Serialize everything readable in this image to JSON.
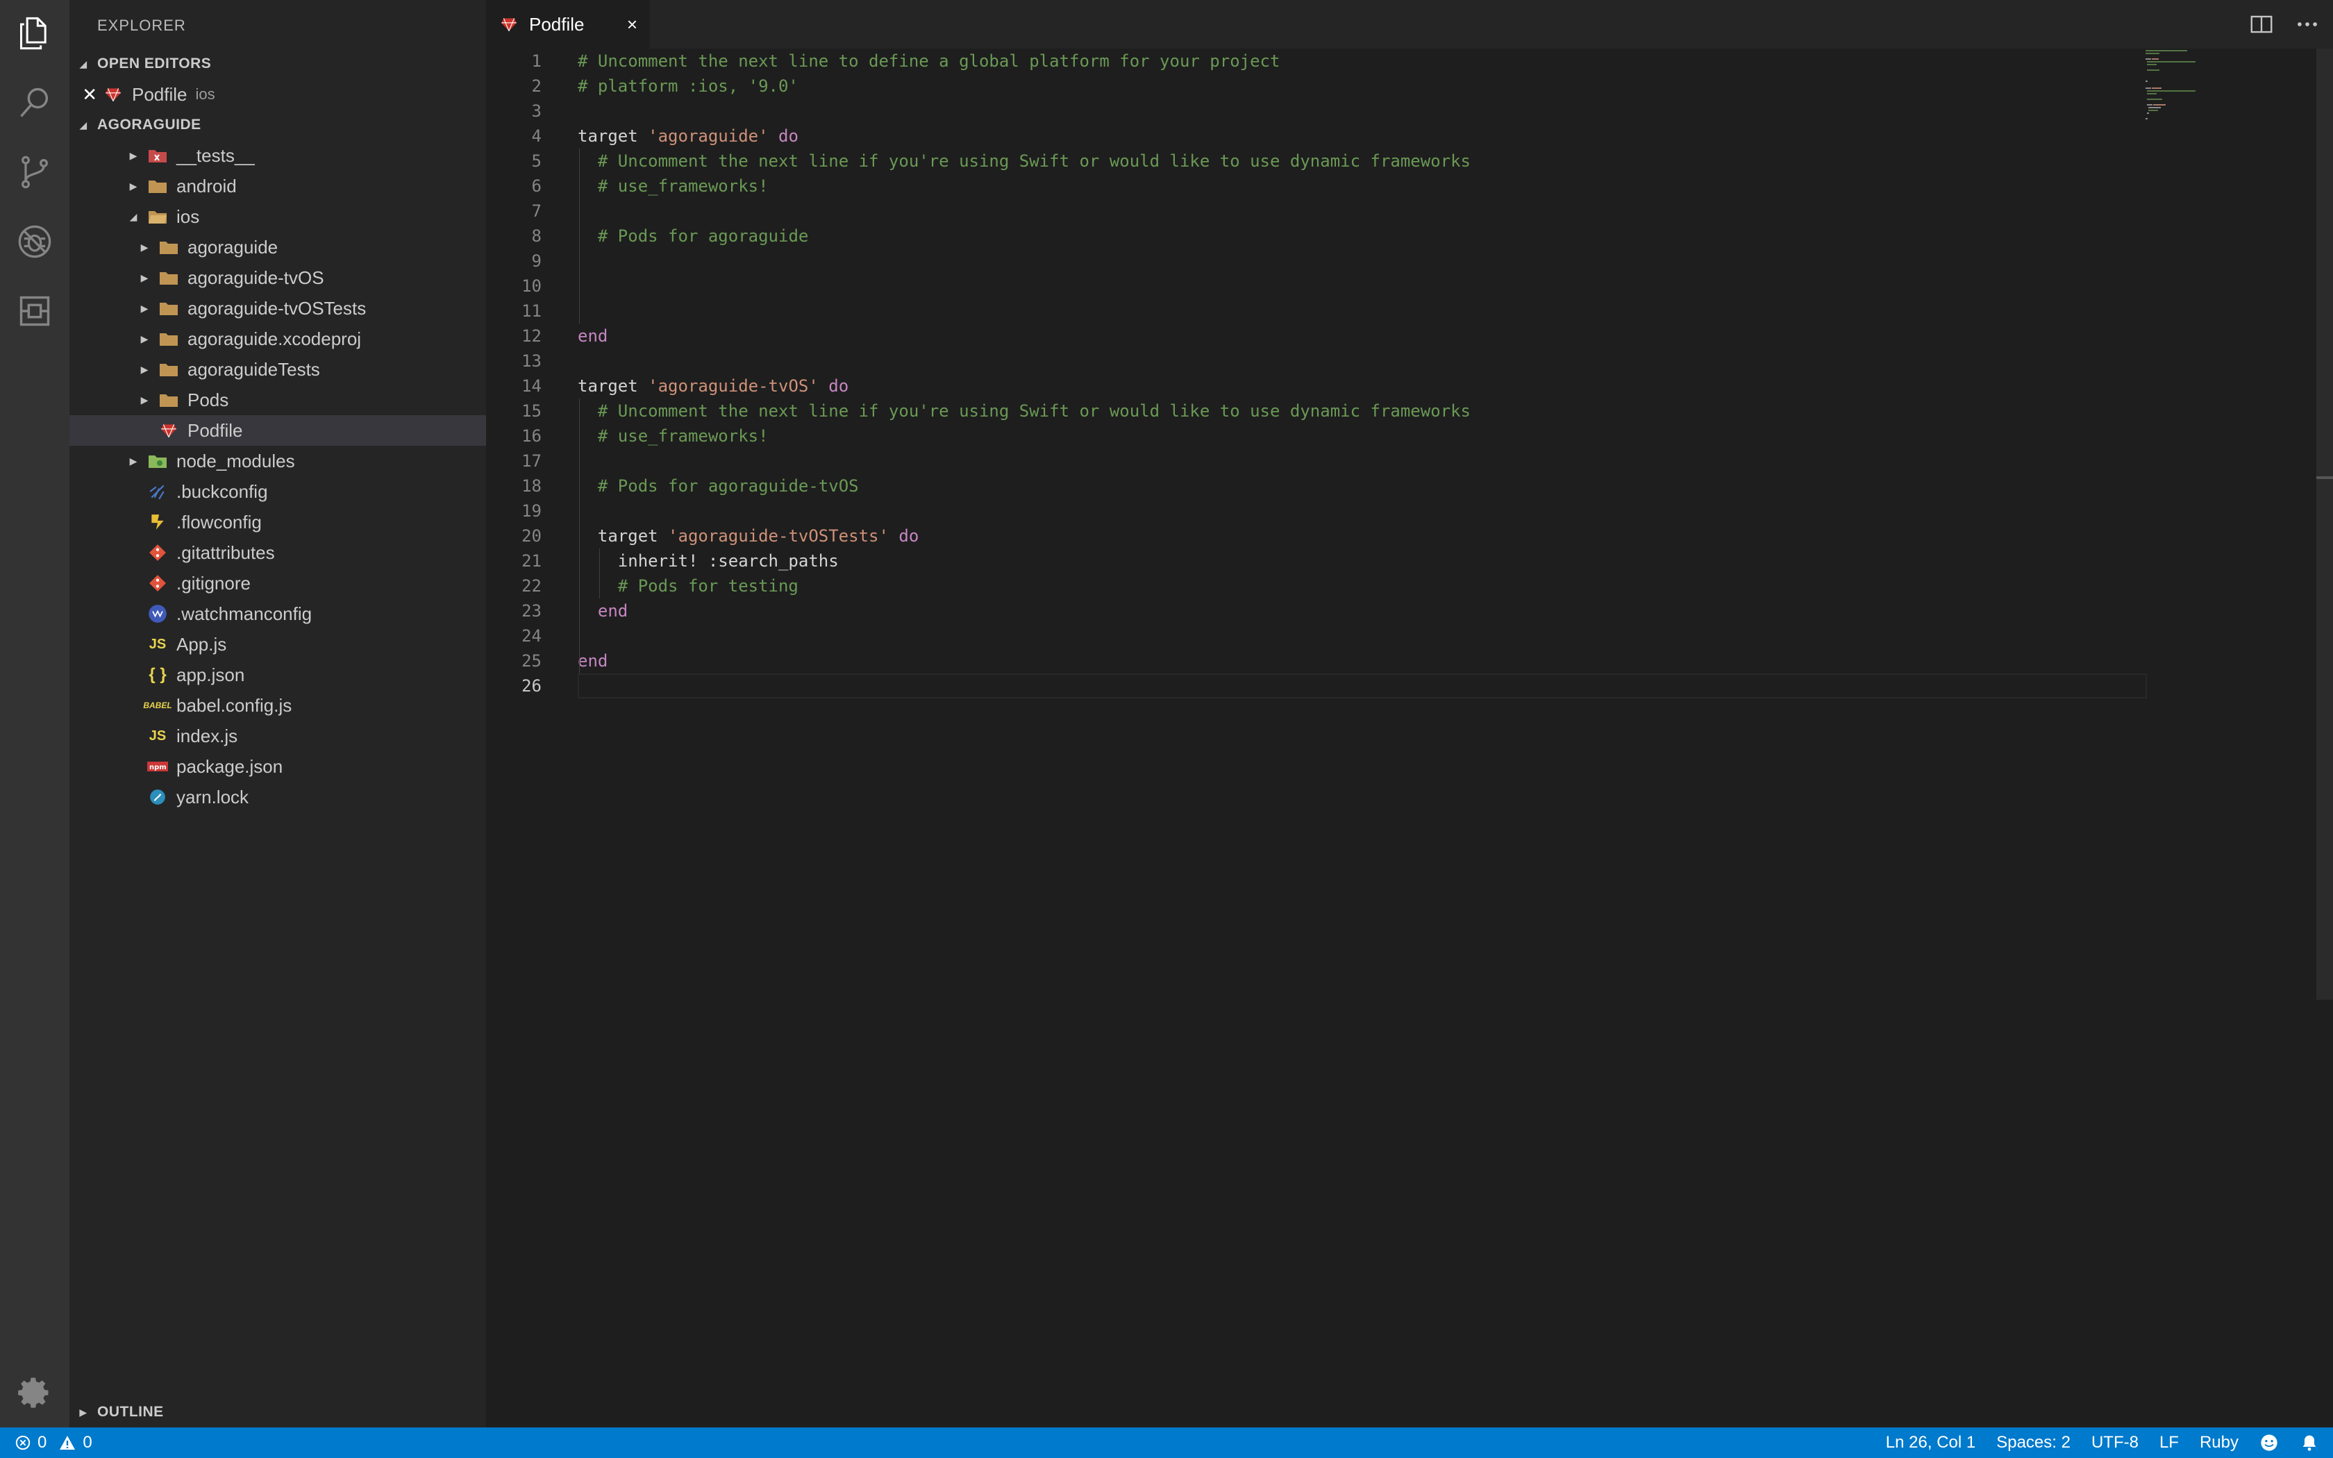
{
  "sidebar": {
    "title": "EXPLORER",
    "open_editors": {
      "label": "OPEN EDITORS",
      "items": [
        {
          "name": "Podfile",
          "desc": "ios"
        }
      ]
    },
    "project": {
      "label": "AGORAGUIDE",
      "tree": [
        {
          "name": "__tests__",
          "type": "folder-tests"
        },
        {
          "name": "android",
          "type": "folder"
        },
        {
          "name": "ios",
          "type": "folder-open"
        },
        {
          "name": "agoraguide",
          "type": "folder"
        },
        {
          "name": "agoraguide-tvOS",
          "type": "folder"
        },
        {
          "name": "agoraguide-tvOSTests",
          "type": "folder"
        },
        {
          "name": "agoraguide.xcodeproj",
          "type": "folder"
        },
        {
          "name": "agoraguideTests",
          "type": "folder"
        },
        {
          "name": "Pods",
          "type": "folder"
        },
        {
          "name": "Podfile",
          "type": "ruby"
        },
        {
          "name": "node_modules",
          "type": "folder-node"
        },
        {
          "name": ".buckconfig",
          "type": "buck"
        },
        {
          "name": ".flowconfig",
          "type": "flow"
        },
        {
          "name": ".gitattributes",
          "type": "git"
        },
        {
          "name": ".gitignore",
          "type": "git"
        },
        {
          "name": ".watchmanconfig",
          "type": "watchman"
        },
        {
          "name": "App.js",
          "type": "js"
        },
        {
          "name": "app.json",
          "type": "json"
        },
        {
          "name": "babel.config.js",
          "type": "babel"
        },
        {
          "name": "index.js",
          "type": "js"
        },
        {
          "name": "package.json",
          "type": "npm"
        },
        {
          "name": "yarn.lock",
          "type": "yarn"
        }
      ]
    },
    "outline_label": "OUTLINE"
  },
  "tab": {
    "label": "Podfile",
    "close": "×"
  },
  "editor": {
    "lines": [
      {
        "n": "1",
        "t": [
          [
            "c",
            "# Uncomment the next line to define a global platform for your project"
          ]
        ]
      },
      {
        "n": "2",
        "t": [
          [
            "c",
            "# platform :ios, '9.0'"
          ]
        ]
      },
      {
        "n": "3",
        "t": []
      },
      {
        "n": "4",
        "t": [
          [
            "p",
            "target "
          ],
          [
            "s",
            "'agoraguide'"
          ],
          [
            "p",
            " "
          ],
          [
            "k",
            "do"
          ]
        ]
      },
      {
        "n": "5",
        "t": [
          [
            "p",
            "  "
          ],
          [
            "c",
            "# Uncomment the next line if you're using Swift or would like to use dynamic frameworks"
          ]
        ]
      },
      {
        "n": "6",
        "t": [
          [
            "p",
            "  "
          ],
          [
            "c",
            "# use_frameworks!"
          ]
        ]
      },
      {
        "n": "7",
        "t": []
      },
      {
        "n": "8",
        "t": [
          [
            "p",
            "  "
          ],
          [
            "c",
            "# Pods for agoraguide"
          ]
        ]
      },
      {
        "n": "9",
        "t": []
      },
      {
        "n": "10",
        "t": []
      },
      {
        "n": "11",
        "t": []
      },
      {
        "n": "12",
        "t": [
          [
            "k",
            "end"
          ]
        ]
      },
      {
        "n": "13",
        "t": []
      },
      {
        "n": "14",
        "t": [
          [
            "p",
            "target "
          ],
          [
            "s",
            "'agoraguide-tvOS'"
          ],
          [
            "p",
            " "
          ],
          [
            "k",
            "do"
          ]
        ]
      },
      {
        "n": "15",
        "t": [
          [
            "p",
            "  "
          ],
          [
            "c",
            "# Uncomment the next line if you're using Swift or would like to use dynamic frameworks"
          ]
        ]
      },
      {
        "n": "16",
        "t": [
          [
            "p",
            "  "
          ],
          [
            "c",
            "# use_frameworks!"
          ]
        ]
      },
      {
        "n": "17",
        "t": []
      },
      {
        "n": "18",
        "t": [
          [
            "p",
            "  "
          ],
          [
            "c",
            "# Pods for agoraguide-tvOS"
          ]
        ]
      },
      {
        "n": "19",
        "t": []
      },
      {
        "n": "20",
        "t": [
          [
            "p",
            "  target "
          ],
          [
            "s",
            "'agoraguide-tvOSTests'"
          ],
          [
            "p",
            " "
          ],
          [
            "k",
            "do"
          ]
        ]
      },
      {
        "n": "21",
        "t": [
          [
            "p",
            "    inherit! :search_paths"
          ]
        ]
      },
      {
        "n": "22",
        "t": [
          [
            "p",
            "    "
          ],
          [
            "c",
            "# Pods for testing"
          ]
        ]
      },
      {
        "n": "23",
        "t": [
          [
            "p",
            "  "
          ],
          [
            "k",
            "end"
          ]
        ]
      },
      {
        "n": "24",
        "t": []
      },
      {
        "n": "25",
        "t": [
          [
            "k",
            "end"
          ]
        ]
      },
      {
        "n": "26",
        "t": []
      }
    ]
  },
  "statusbar": {
    "errors": "0",
    "warnings": "0",
    "position": "Ln 26, Col 1",
    "spaces": "Spaces: 2",
    "encoding": "UTF-8",
    "eol": "LF",
    "language": "Ruby"
  },
  "colors": {
    "accent": "#007acc",
    "comment": "#6a9955",
    "keyword": "#c586c0",
    "string": "#ce9178",
    "ruby": "#cc342d",
    "folder": "#c09553"
  }
}
